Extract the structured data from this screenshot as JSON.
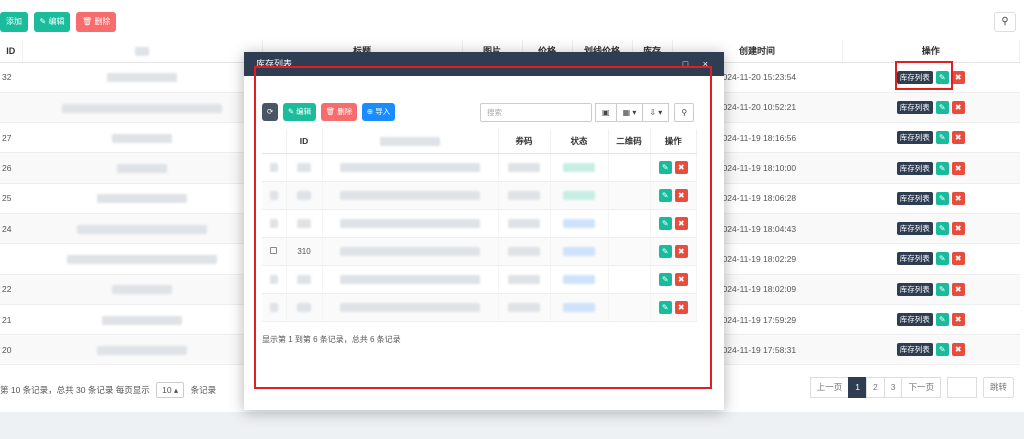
{
  "toolbar": {
    "add_label": "添加",
    "edit_label": "✎ 编辑",
    "delete_label": "🗑 删除",
    "search_icon": "search-icon"
  },
  "main_table": {
    "headers": [
      "ID",
      "",
      "标题",
      "图片",
      "价格",
      "划线价格",
      "库存",
      "创建时间",
      "操作"
    ],
    "rows": [
      {
        "id": "32",
        "created": "2024-11-20 15:23:54"
      },
      {
        "id": "",
        "created": "2024-11-20 10:52:21"
      },
      {
        "id": "27",
        "created": "2024-11-19 18:16:56"
      },
      {
        "id": "26",
        "created": "2024-11-19 18:10:00"
      },
      {
        "id": "25",
        "created": "2024-11-19 18:06:28"
      },
      {
        "id": "24",
        "created": "2024-11-19 18:04:43"
      },
      {
        "id": "",
        "created": "2024-11-19 18:02:29"
      },
      {
        "id": "22",
        "created": "2024-11-19 18:02:09"
      },
      {
        "id": "21",
        "created": "2024-11-19 17:59:29"
      },
      {
        "id": "20",
        "created": "2024-11-19 17:58:31"
      }
    ],
    "op_stock_label": "库存列表",
    "footer_text": "第 10 条记录，总共 30 条记录 每页显示",
    "page_size": "10",
    "footer_tail": "条记录"
  },
  "pager": {
    "prev": "上一页",
    "pages": [
      "1",
      "2",
      "3"
    ],
    "active": "1",
    "next": "下一页",
    "jump": "跳转"
  },
  "modal": {
    "title": "库存列表",
    "window_controls": "□ ×",
    "toolbar": {
      "refresh_icon": "refresh-icon",
      "edit_label": "✎ 编辑",
      "delete_label": "🗑 删除",
      "import_label": "⊕ 导入"
    },
    "search_placeholder": "搜索",
    "headers": [
      "",
      "ID",
      "",
      "券码",
      "状态",
      "二维码",
      "操作"
    ],
    "rows": [
      {
        "id": ""
      },
      {
        "id": ""
      },
      {
        "id": ""
      },
      {
        "id": "310"
      },
      {
        "id": ""
      },
      {
        "id": ""
      }
    ],
    "footer": "显示第 1 到第 6 条记录，总共 6 条记录"
  },
  "colors": {
    "dark": "#2f3d52",
    "teal": "#1abc9c",
    "red": "#f76c6c",
    "blue": "#1a8cff",
    "highlight": "#e02020"
  }
}
